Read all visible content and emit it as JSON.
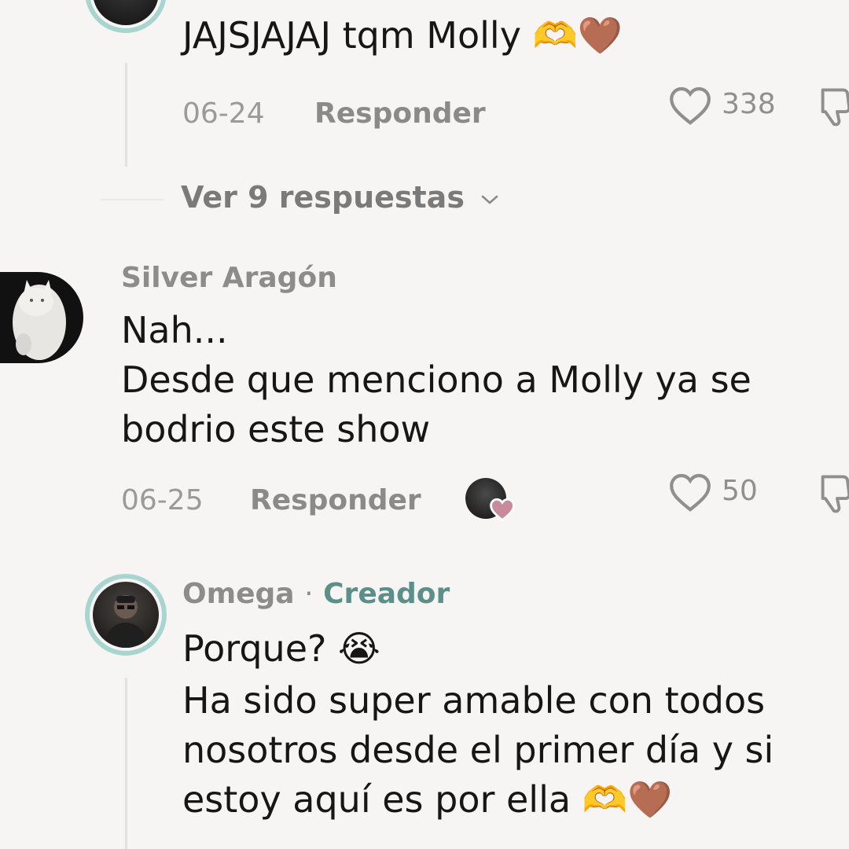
{
  "comment_top": {
    "text": "JAJSJAJAJ tqm Molly 🫶🤎",
    "date": "06-24",
    "reply_label": "Responder",
    "likes": "338"
  },
  "view_replies_label": "Ver 9 respuestas",
  "comment_silver": {
    "username": "Silver Aragón",
    "line1": "Nah...",
    "line2": "Desde que menciono a Molly ya se",
    "line3": "bodrio este show",
    "date": "06-25",
    "reply_label": "Responder",
    "likes": "50"
  },
  "comment_omega": {
    "username": "Omega",
    "separator": "·",
    "creator_label": "Creador",
    "line1": "Porque? 😭",
    "line2": "Ha sido super amable con todos",
    "line3": "nosotros desde el primer día y si",
    "line4": "estoy aquí es por ella 🫶🤎"
  },
  "icons": {
    "like": "heart-outline-icon",
    "dislike": "thumbs-down-icon",
    "chevron": "chevron-down-icon",
    "creator_liked_badge": "heart-filled-icon"
  },
  "colors": {
    "accent_ring": "#a8d5d0",
    "creator_text": "#5b8f88",
    "liked_heart": "#c98b9b"
  }
}
